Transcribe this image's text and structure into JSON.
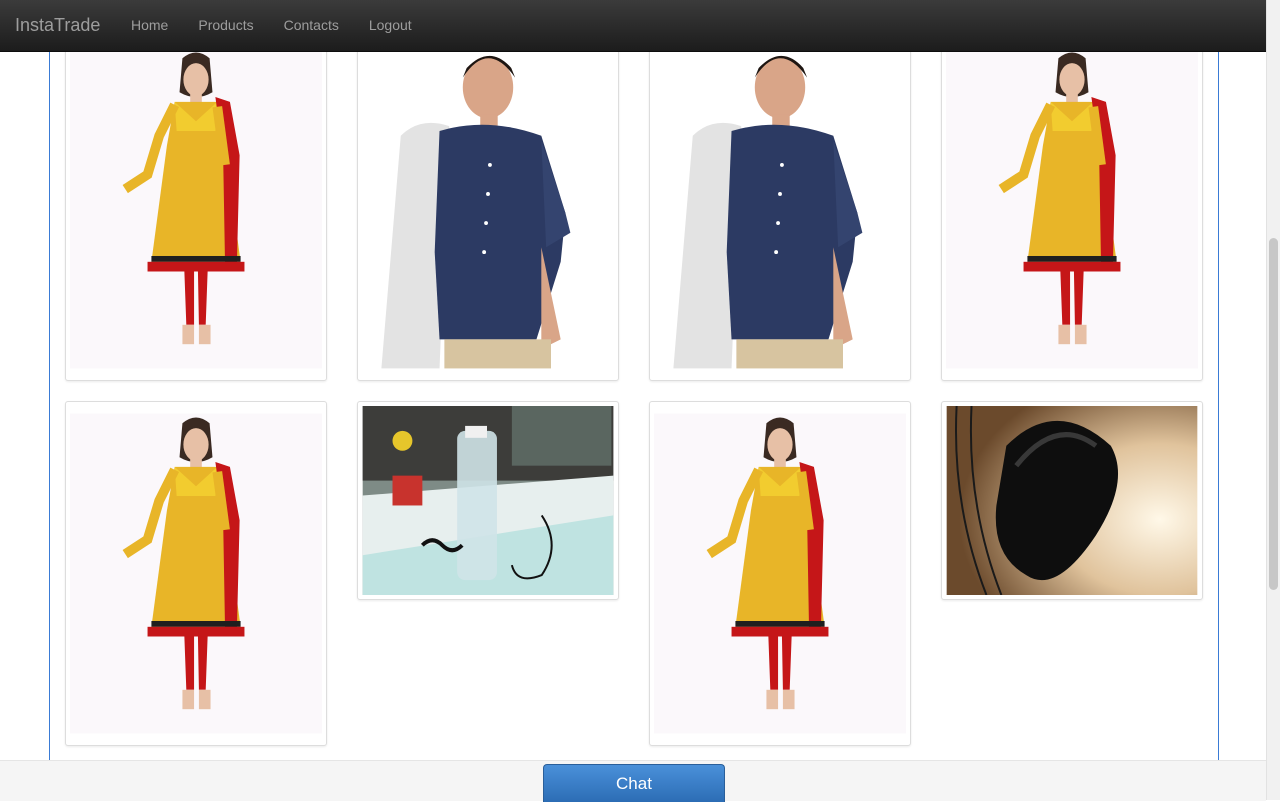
{
  "app": {
    "brand": "InstaTrade"
  },
  "nav": {
    "items": [
      "Home",
      "Products",
      "Contacts",
      "Logout"
    ]
  },
  "products": [
    {
      "image": "woman-yellow-kurta"
    },
    {
      "image": "man-navy-shirt"
    },
    {
      "image": "man-navy-shirt"
    },
    {
      "image": "woman-yellow-kurta"
    },
    {
      "image": "woman-yellow-kurta"
    },
    {
      "image": "desk-water-bottle-photo"
    },
    {
      "image": "woman-yellow-kurta"
    },
    {
      "image": "black-computer-mouse-photo"
    }
  ],
  "footer": {
    "chat_label": "Chat"
  },
  "colors": {
    "navbar": "#222222",
    "chat_button": "#3a7bc8",
    "container_border": "#3a7bd5"
  }
}
